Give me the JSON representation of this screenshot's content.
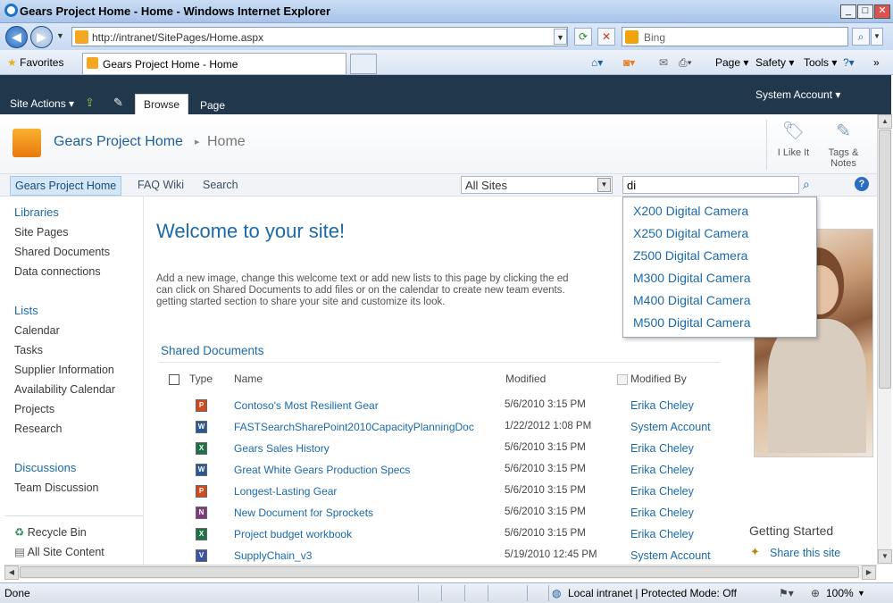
{
  "window": {
    "title": "Gears Project Home - Home - Windows Internet Explorer"
  },
  "browser": {
    "address": "http://intranet/SitePages/Home.aspx",
    "search_placeholder": "Bing",
    "favorites_label": "Favorites",
    "tab_title": "Gears Project Home - Home",
    "commands": {
      "page": "Page",
      "safety": "Safety",
      "tools": "Tools"
    }
  },
  "ribbon": {
    "site_actions": "Site Actions",
    "tabs": [
      "Browse",
      "Page"
    ],
    "user": "System Account"
  },
  "site": {
    "title": "Gears Project Home",
    "separator": "▸",
    "page": "Home"
  },
  "social": {
    "like": "I Like It",
    "tags": "Tags &",
    "notes": "Notes"
  },
  "topnav": {
    "items": [
      "Gears Project Home",
      "FAQ Wiki",
      "Search"
    ],
    "scope": "All Sites",
    "query": "di"
  },
  "suggestions": [
    "X200 Digital Camera",
    "X250 Digital Camera",
    "Z500 Digital Camera",
    "M300 Digital Camera",
    "M400 Digital Camera",
    "M500 Digital Camera"
  ],
  "leftnav": {
    "libraries": {
      "heading": "Libraries",
      "items": [
        "Site Pages",
        "Shared Documents",
        "Data connections"
      ]
    },
    "lists": {
      "heading": "Lists",
      "items": [
        "Calendar",
        "Tasks",
        "Supplier Information",
        "Availability Calendar",
        "Projects",
        "Research"
      ]
    },
    "discussions": {
      "heading": "Discussions",
      "items": [
        "Team Discussion"
      ]
    },
    "recycle_bin": "Recycle Bin",
    "all_content": "All Site Content"
  },
  "main": {
    "welcome": "Welcome to your site!",
    "intro_lines": [
      "Add a new image, change this welcome text or add new lists to this page by clicking the ed",
      "can click on Shared Documents to add files or on the calendar to create new team events.",
      "getting started section to share your site and customize its look."
    ]
  },
  "docs": {
    "title": "Shared Documents",
    "columns": {
      "type": "Type",
      "name": "Name",
      "modified": "Modified",
      "modified_by": "Modified By"
    },
    "rows": [
      {
        "icon": "ppt",
        "name": "Contoso's Most Resilient Gear",
        "modified": "5/6/2010 3:15 PM",
        "by": "Erika Cheley"
      },
      {
        "icon": "word",
        "name": "FASTSearchSharePoint2010CapacityPlanningDoc",
        "modified": "1/22/2012 1:08 PM",
        "by": "System Account"
      },
      {
        "icon": "excel",
        "name": "Gears Sales History",
        "modified": "5/6/2010 3:15 PM",
        "by": "Erika Cheley"
      },
      {
        "icon": "word",
        "name": "Great White Gears Production Specs",
        "modified": "5/6/2010 3:15 PM",
        "by": "Erika Cheley"
      },
      {
        "icon": "ppt",
        "name": "Longest-Lasting Gear",
        "modified": "5/6/2010 3:15 PM",
        "by": "Erika Cheley"
      },
      {
        "icon": "onenote",
        "name": "New Document for Sprockets",
        "modified": "5/6/2010 3:15 PM",
        "by": "Erika Cheley"
      },
      {
        "icon": "excel",
        "name": "Project budget workbook",
        "modified": "5/6/2010 3:15 PM",
        "by": "Erika Cheley"
      },
      {
        "icon": "visio",
        "name": "SupplyChain_v3",
        "modified": "5/19/2010 12:45 PM",
        "by": "System Account"
      }
    ]
  },
  "getting_started": {
    "title": "Getting Started",
    "share": "Share this site"
  },
  "status": {
    "text": "Done",
    "zone": "Local intranet | Protected Mode: Off",
    "zoom": "100%"
  },
  "colors": {
    "ribbon": "#21374c",
    "link": "#1a6aab",
    "ppt": "#d04a1d",
    "word": "#2b5797",
    "excel": "#1e7145",
    "onenote": "#80397b",
    "visio": "#3955a3"
  }
}
